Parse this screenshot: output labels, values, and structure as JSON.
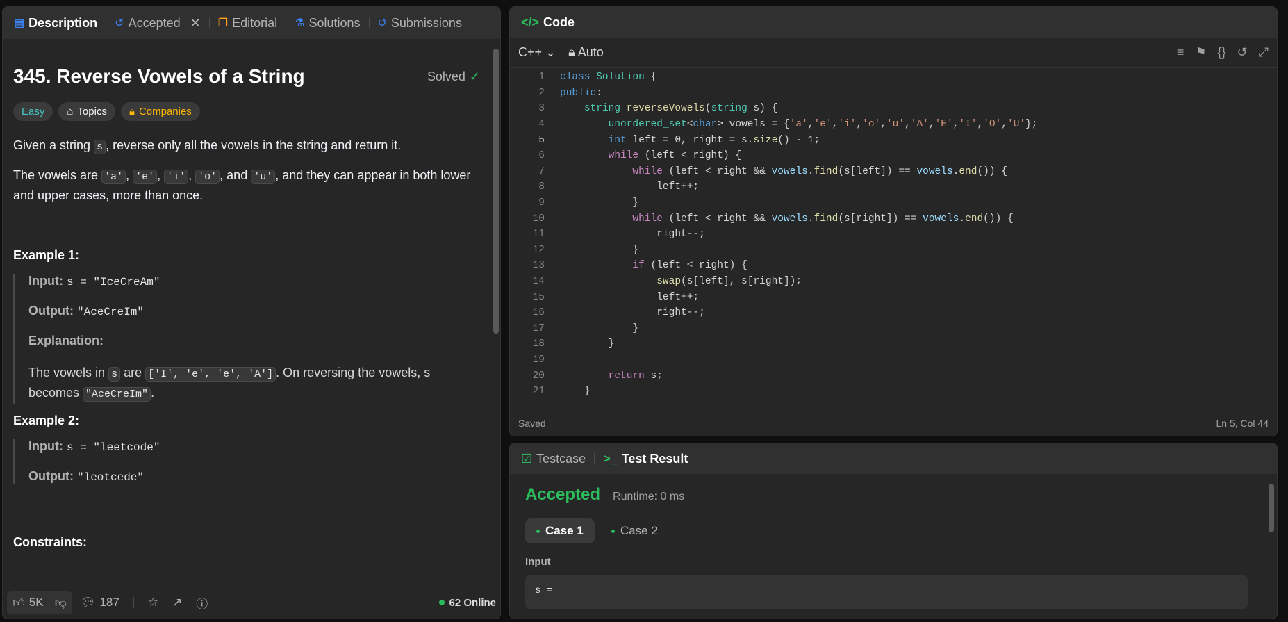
{
  "left_tabs": [
    {
      "label": "Description",
      "icon": "description-icon"
    },
    {
      "label": "Accepted",
      "icon": "history-icon"
    },
    {
      "label": "Editorial",
      "icon": "book-icon"
    },
    {
      "label": "Solutions",
      "icon": "flask-icon"
    },
    {
      "label": "Submissions",
      "icon": "history-icon"
    }
  ],
  "problem": {
    "title": "345. Reverse Vowels of a String",
    "status": "Solved",
    "difficulty": "Easy",
    "topics_label": "Topics",
    "companies_label": "Companies",
    "p1_a": "Given a string ",
    "p1_code": "s",
    "p1_b": ", reverse only all the vowels in the string and return it.",
    "p2_a": "The vowels are ",
    "v1": "'a'",
    "v2": "'e'",
    "v3": "'i'",
    "v4": "'o'",
    "v5": "'u'",
    "p2_and": ", and ",
    "p2_b": ", and they can appear in both lower and upper cases, more than once.",
    "ex1_title": "Example 1:",
    "input_label": "Input:",
    "output_label": "Output:",
    "explanation_label": "Explanation:",
    "ex1_input": "s = \"IceCreAm\"",
    "ex1_output": "\"AceCreIm\"",
    "ex1_exp_a": "The vowels in ",
    "ex1_exp_s": "s",
    "ex1_exp_b": " are ",
    "ex1_exp_list": "['I', 'e', 'e', 'A']",
    "ex1_exp_c": ". On reversing the vowels, s becomes ",
    "ex1_exp_res": "\"AceCreIm\"",
    "ex2_title": "Example 2:",
    "ex2_input": "s = \"leetcode\"",
    "ex2_output": "\"leotcede\"",
    "constraints_title": "Constraints:"
  },
  "bottom": {
    "likes": "5K",
    "comments": "187",
    "online": "62 Online"
  },
  "code_panel": {
    "title": "Code",
    "language": "C++",
    "mode": "Auto",
    "saved": "Saved",
    "cursor": "Ln 5, Col 44"
  },
  "result_panel": {
    "tab_testcase": "Testcase",
    "tab_result": "Test Result",
    "status": "Accepted",
    "runtime": "Runtime: 0 ms",
    "case1": "Case 1",
    "case2": "Case 2",
    "input_label": "Input",
    "input_value": "s ="
  },
  "colors": {
    "accent_green": "#2cbb5d",
    "easy": "#46c6c2",
    "companies": "#ffb800",
    "tab_blue": "#3b82f6"
  }
}
